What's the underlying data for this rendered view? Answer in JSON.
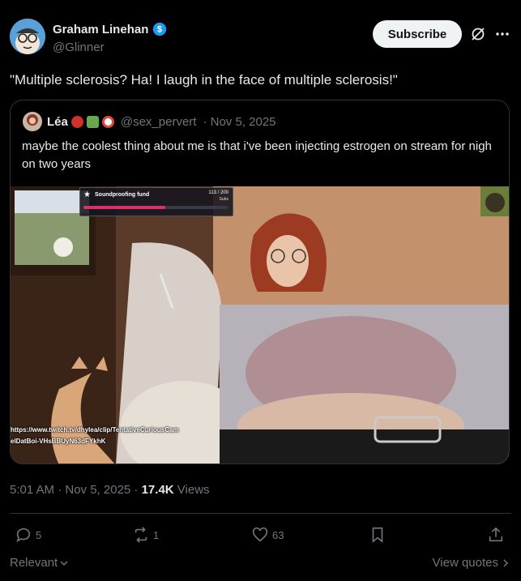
{
  "post": {
    "author_name": "Graham Linehan",
    "author_handle": "@Glinner",
    "subscribe_label": "Subscribe",
    "text": "\"Multiple sclerosis? Ha! I laugh in the face of multiple sclerosis!\"",
    "timestamp": "5:01 AM · Nov 5, 2025 · ",
    "views_count": "17.4K",
    "views_label": " Views"
  },
  "quoted_post": {
    "author_name": "Léa",
    "author_handle": "@sex_pervert",
    "date": "· Nov 5, 2025",
    "text": "maybe the coolest thing about me is that i've been injecting estrogen on stream for nigh on two years",
    "media": {
      "overlay_title": "Soundproofing fund",
      "overlay_count": "113 / 200",
      "overlay_unit": "Subs",
      "progress": 0.565,
      "clip_url_line1": "https://www.twitch.tv/dhylea/clip/TentativeCuriousCam",
      "clip_url_line2": "elDatBoi-VHsBBUyN63dFYkhK"
    }
  },
  "actions": {
    "replies": "5",
    "reposts": "1",
    "likes": "63"
  },
  "footer": {
    "sort_label": "Relevant",
    "view_quotes_label": "View quotes"
  },
  "colors": {
    "background": "#000000",
    "text_primary": "#e7e9ea",
    "text_secondary": "#71767b",
    "border": "#2f3336",
    "verified": "#1d9bf0",
    "progress": "#d6336c"
  }
}
